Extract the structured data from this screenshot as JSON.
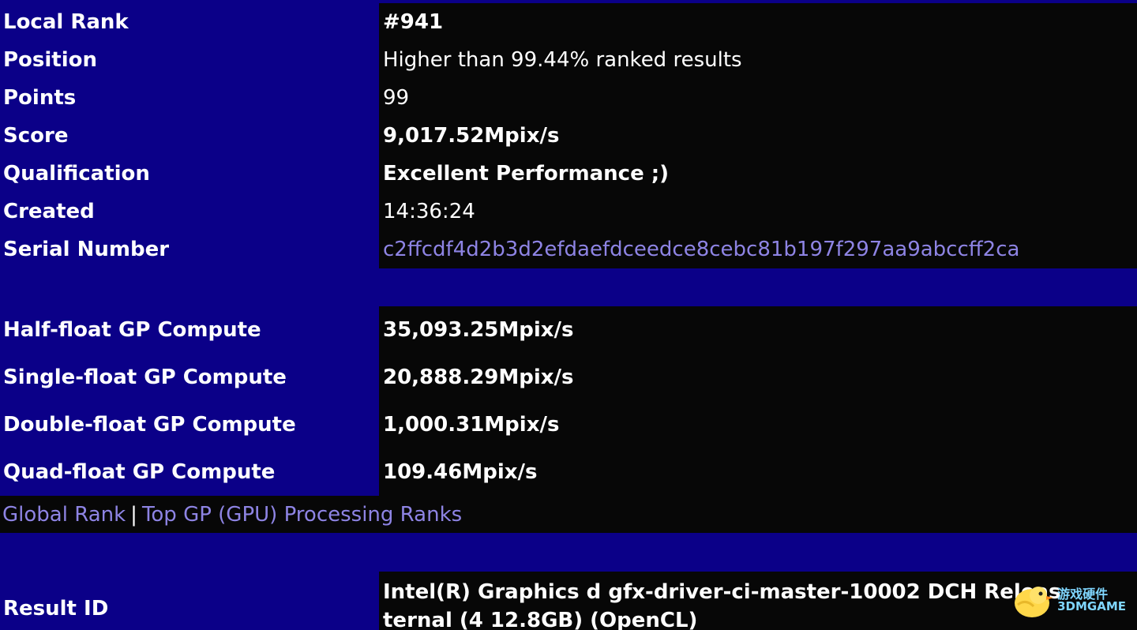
{
  "info_rows": [
    {
      "label": "Local Rank",
      "value": "#941"
    },
    {
      "label": "Position",
      "value": "Higher than 99.44% ranked results"
    },
    {
      "label": "Points",
      "value": "99"
    },
    {
      "label": "Score",
      "value": "9,017.52Mpix/s"
    },
    {
      "label": "Qualification",
      "value": "Excellent Performance ;)"
    },
    {
      "label": "Created",
      "value": "14:36:24"
    },
    {
      "label": "Serial Number",
      "value": "c2ffcdf4d2b3d2efdaefdceedce8cebc81b197f297aa9abccff2ca"
    }
  ],
  "compute_rows": [
    {
      "label": "Half-float GP Compute",
      "value": "35,093.25Mpix/s"
    },
    {
      "label": "Single-float GP Compute",
      "value": "20,888.29Mpix/s"
    },
    {
      "label": "Double-float GP Compute",
      "value": "1,000.31Mpix/s"
    },
    {
      "label": "Quad-float GP Compute",
      "value": "109.46Mpix/s"
    }
  ],
  "ranks": {
    "global_rank": "Global Rank",
    "separator": "|",
    "top_gp": "Top GP (GPU) Processing Ranks"
  },
  "result": {
    "label": "Result ID",
    "value": "Intel(R) Graphics d gfx-driver-ci-master-10002 DCH Releas    ternal (4 12.8GB) (OpenCL)"
  },
  "watermark": {
    "cn": "游戏硬件",
    "en": "3DMGAME"
  },
  "colors": {
    "label_bg": "#0b0088",
    "value_bg": "#070707",
    "link": "#8e84e4",
    "text": "#ffffff"
  }
}
